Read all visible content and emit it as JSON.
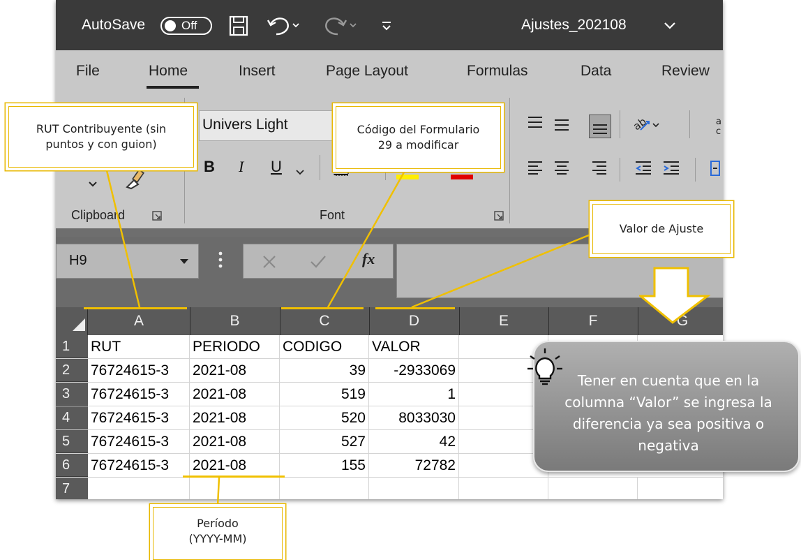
{
  "titlebar": {
    "autosave_label": "AutoSave",
    "autosave_state": "Off",
    "filename": "Ajustes_202108"
  },
  "tabs": [
    "File",
    "Home",
    "Insert",
    "Page Layout",
    "Formulas",
    "Data",
    "Review"
  ],
  "ribbon": {
    "font_name": "Univers Light",
    "group_clipboard": "Clipboard",
    "group_font": "Font",
    "bold": "B",
    "italic": "I",
    "underline": "U"
  },
  "formula_bar": {
    "name_box": "H9",
    "fx": "fx"
  },
  "columns": [
    "A",
    "B",
    "C",
    "D",
    "E",
    "F",
    "G"
  ],
  "row_numbers": [
    "1",
    "2",
    "3",
    "4",
    "5",
    "6",
    "7"
  ],
  "table": {
    "headers": [
      "RUT",
      "PERIODO",
      "CODIGO",
      "VALOR"
    ],
    "rows": [
      [
        "76724615-3",
        "2021-08",
        "39",
        "-2933069"
      ],
      [
        "76724615-3",
        "2021-08",
        "519",
        "1"
      ],
      [
        "76724615-3",
        "2021-08",
        "520",
        "8033030"
      ],
      [
        "76724615-3",
        "2021-08",
        "527",
        "42"
      ],
      [
        "76724615-3",
        "2021-08",
        "155",
        "72782"
      ]
    ]
  },
  "callouts": {
    "rut": "RUT Contribuyente (sin puntos y con guion)",
    "codigo": "Código del Formulario 29 a modificar",
    "valor": "Valor de Ajuste",
    "periodo": "Período (YYYY-MM)"
  },
  "tip": "Tener en cuenta que en la columna “Valor” se ingresa la diferencia ya sea positiva o negativa",
  "colors": {
    "title_bar": "#3a3a3a",
    "ribbon": "#c8c8c8",
    "callout_border": "#e8b800",
    "tip_box": "#8a8a8a",
    "highlight_yellow": "#ffee00",
    "font_red": "#e00000"
  }
}
